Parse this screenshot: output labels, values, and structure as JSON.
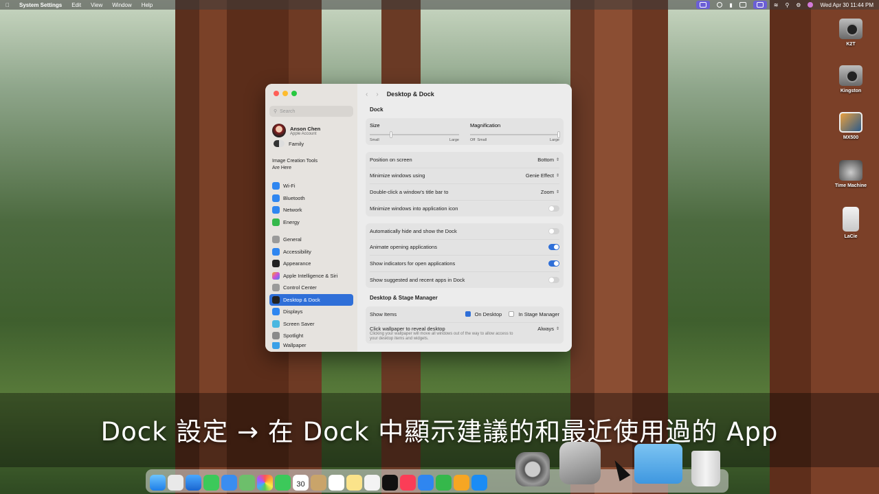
{
  "menubar": {
    "app_name": "System Settings",
    "menus": [
      "Edit",
      "View",
      "Window",
      "Help"
    ],
    "clock": "Wed Apr 30  11:44 PM"
  },
  "desktop": {
    "volumes": [
      "K2T",
      "Kingston",
      "MX500",
      "Time Machine",
      "LaCie"
    ]
  },
  "settings": {
    "search_placeholder": "Search",
    "account": {
      "name": "Anson Chen",
      "subtitle": "Apple Account"
    },
    "family": "Family",
    "promo": [
      "Image Creation Tools",
      "Are Here"
    ],
    "nav_group1": [
      "Wi-Fi",
      "Bluetooth",
      "Network",
      "Energy"
    ],
    "nav_group2": [
      "General",
      "Accessibility",
      "Appearance",
      "Apple Intelligence & Siri",
      "Control Center",
      "Desktop & Dock",
      "Displays",
      "Screen Saver",
      "Spotlight",
      "Wallpaper"
    ],
    "active_item": "Desktop & Dock",
    "page_title": "Desktop & Dock",
    "dock_section": "Dock",
    "size_label": "Size",
    "size_small": "Small",
    "size_large": "Large",
    "magnification_label": "Magnification",
    "mag_off": "Off",
    "mag_small": "Small",
    "mag_large": "Large",
    "rows": {
      "position": {
        "label": "Position on screen",
        "value": "Bottom"
      },
      "minimize_using": {
        "label": "Minimize windows using",
        "value": "Genie Effect"
      },
      "double_click": {
        "label": "Double-click a window's title bar to",
        "value": "Zoom"
      },
      "minimize_into_icon": {
        "label": "Minimize windows into application icon",
        "on": false
      }
    },
    "toggles": [
      {
        "label": "Automatically hide and show the Dock",
        "on": false
      },
      {
        "label": "Animate opening applications",
        "on": true
      },
      {
        "label": "Show indicators for open applications",
        "on": true
      },
      {
        "label": "Show suggested and recent apps in Dock",
        "on": false
      }
    ],
    "stage_section": "Desktop & Stage Manager",
    "show_items": {
      "label": "Show Items",
      "on_desktop": "On Desktop",
      "in_stage_manager": "In Stage Manager"
    },
    "click_wallpaper": {
      "label": "Click wallpaper to reveal desktop",
      "value": "Always",
      "desc": "Clicking your wallpaper will move all windows out of the way to allow access to your desktop items and widgets."
    }
  },
  "caption": "Dock 設定 → 在 Dock 中顯示建議的和最近使用過的 App",
  "dock": {
    "calendar_day": "30"
  },
  "colors": {
    "accent": "#2f6fd8"
  }
}
